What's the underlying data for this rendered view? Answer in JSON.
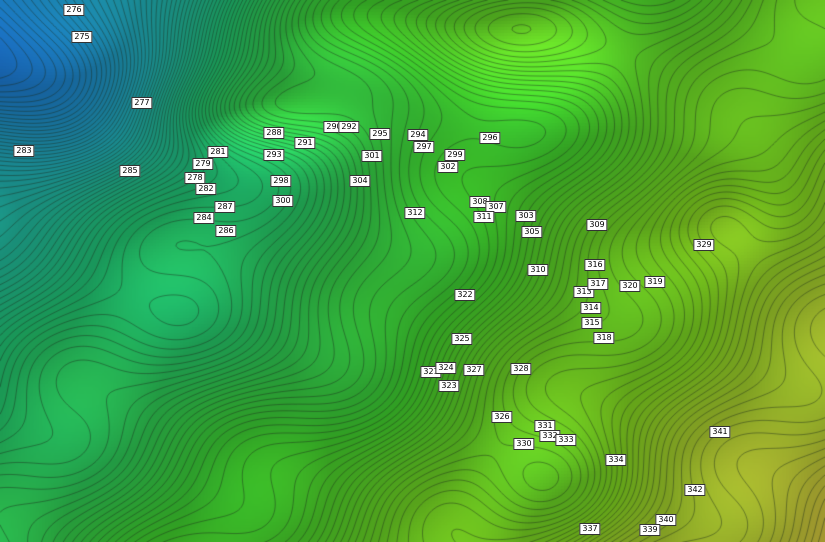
{
  "map": {
    "type": "contour-terrain",
    "contour_color": "#1a2a1a",
    "color_ramp": [
      "#1a6fc4",
      "#1fa6b0",
      "#1fb86a",
      "#3cc22a",
      "#7ac81e",
      "#c8b83a"
    ],
    "elevation_labels": [
      "276",
      "275",
      "277",
      "283",
      "285",
      "279",
      "281",
      "278",
      "282",
      "287",
      "284",
      "286",
      "288",
      "293",
      "291",
      "290",
      "292",
      "298",
      "300",
      "295",
      "301",
      "304",
      "294",
      "297",
      "299",
      "302",
      "296",
      "312",
      "308",
      "307",
      "311",
      "303",
      "305",
      "309",
      "329",
      "310",
      "316",
      "313",
      "317",
      "320",
      "319",
      "314",
      "315",
      "322",
      "318",
      "325",
      "321",
      "324",
      "327",
      "328",
      "323",
      "326",
      "331",
      "332",
      "333",
      "330",
      "334",
      "341",
      "342",
      "340",
      "339",
      "337"
    ]
  }
}
